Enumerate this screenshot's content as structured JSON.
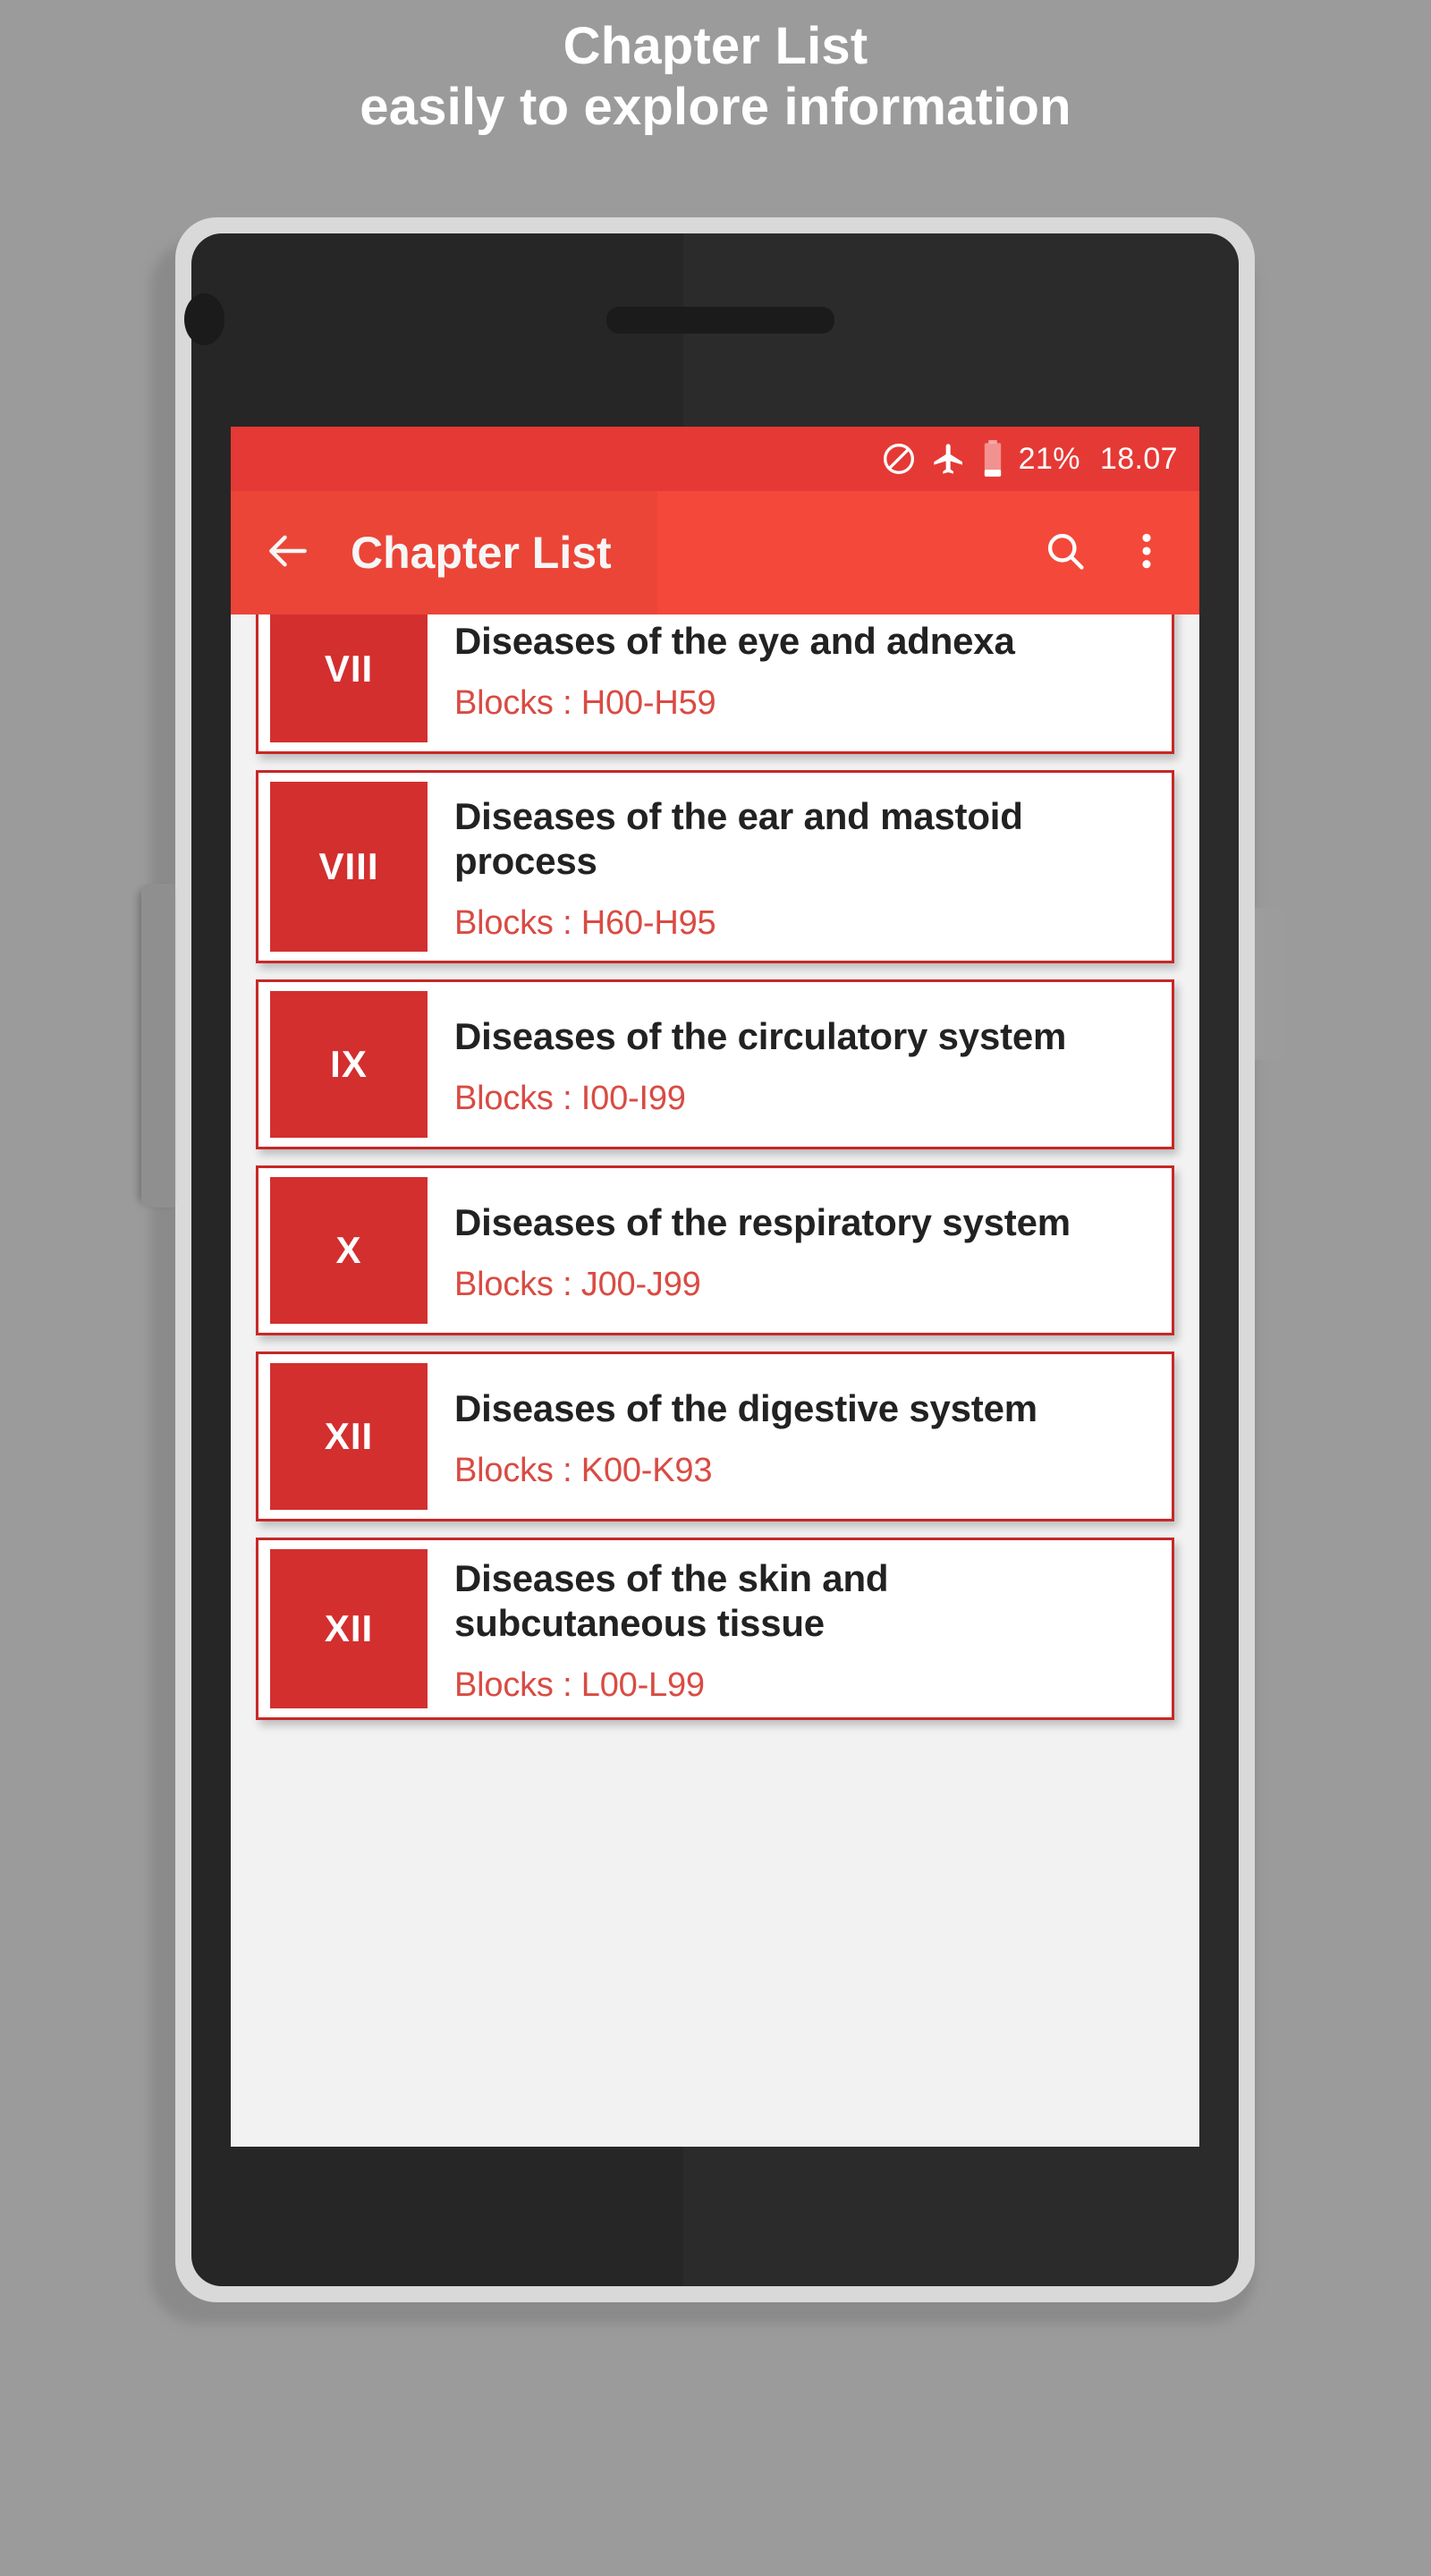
{
  "promo": {
    "line1": "Chapter List",
    "line2": "easily to explore information"
  },
  "colors": {
    "page_background": "#9b9b9b",
    "status_bar": "#e53935",
    "app_bar": "#f4483a",
    "badge": "#d32f2f",
    "card_border": "#c62828",
    "subtitle_text": "#d94b43",
    "screen_background": "#f2f2f2",
    "title_text": "#222222",
    "device_frame": "#d9d9d9",
    "device_bezel": "#2b2b2b"
  },
  "status_bar": {
    "icons": [
      "do-not-disturb-icon",
      "airplane-mode-icon",
      "battery-icon"
    ],
    "battery": "21%",
    "time": "18.07"
  },
  "app_bar": {
    "back_label": "back-arrow",
    "title": "Chapter List",
    "search_label": "search",
    "overflow_label": "more-options"
  },
  "list": {
    "items": [
      {
        "numeral": "VII",
        "title": "Diseases of the eye and adnexa",
        "blocks": "Blocks : H00-H59"
      },
      {
        "numeral": "VIII",
        "title": "Diseases of the ear and mastoid process",
        "blocks": "Blocks : H60-H95"
      },
      {
        "numeral": "IX",
        "title": "Diseases of the circulatory system",
        "blocks": "Blocks : I00-I99"
      },
      {
        "numeral": "X",
        "title": "Diseases of the respiratory system",
        "blocks": "Blocks : J00-J99"
      },
      {
        "numeral": "XII",
        "title": "Diseases of the digestive system",
        "blocks": "Blocks : K00-K93"
      },
      {
        "numeral": "XII",
        "title": "Diseases of the skin and subcutaneous tissue",
        "blocks": "Blocks : L00-L99"
      }
    ]
  }
}
